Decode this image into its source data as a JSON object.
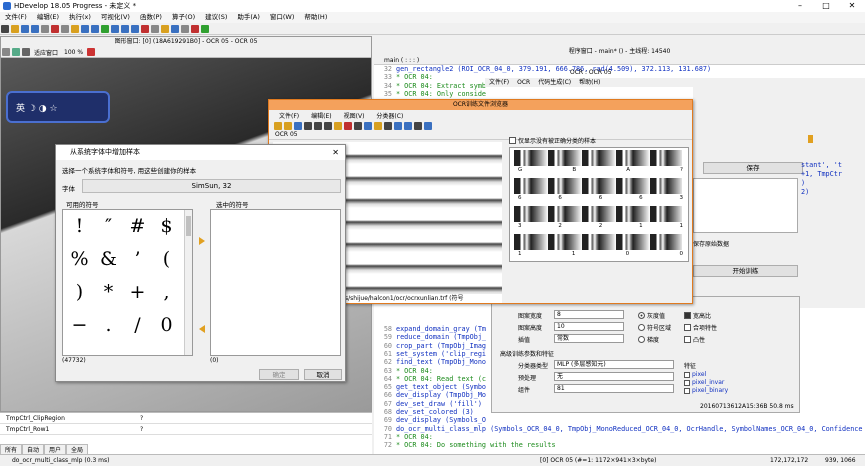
{
  "app": {
    "title": "HDevelop 18.05 Progress - 未定义 *"
  },
  "menu": [
    "文件(F)",
    "编辑(E)",
    "执行(x)",
    "可视化(V)",
    "函数(P)",
    "算子(O)",
    "建议(S)",
    "助手(A)",
    "窗口(W)",
    "帮助(H)"
  ],
  "graphics": {
    "title": "图形窗口: [0] (18A619291B0] - OCR 05 - OCR 05",
    "zoom_select": "适应窗口",
    "zoom_pct": "100 %"
  },
  "logo": {
    "text": "英 ☽ ◑ ☆"
  },
  "symbol_dialog": {
    "title": "从系统字体中增加样本",
    "instruction": "选择一个系统字体和符号, 用这些创建你的样本",
    "font_label": "字体",
    "font_value": "SimSun, 32",
    "available_label": "可用的符号",
    "selected_label": "选中的符号",
    "symbols": [
      "!",
      "″",
      "#",
      "$",
      "%",
      "&",
      "’",
      "(",
      ")",
      "*",
      "+",
      ",",
      "−",
      ".",
      "/",
      "0"
    ],
    "count_available": "(47732)",
    "count_selected": "(0)",
    "ok": "确定",
    "cancel": "取消"
  },
  "ocr_dialog": {
    "title": "OCR训练文件浏览器",
    "menu": [
      "文件(F)",
      "编辑(E)",
      "视图(V)",
      "分类器(C)"
    ],
    "tab": "OCR 05",
    "checkbox": "仅显示没有被正确分类的样本",
    "rows": [
      [
        "G",
        "B",
        "A",
        "?"
      ],
      [
        "6",
        "6",
        "6",
        "6",
        "3"
      ],
      [
        "3",
        "2",
        "2",
        "1",
        "1"
      ],
      [
        "1",
        "1",
        "0",
        "0"
      ]
    ],
    "path": "s/shijue/halcon1/ocr/ocrxunlian.trf (符号"
  },
  "assistant_menu": [
    "文件(F)",
    "OCR",
    "代码生成(C)",
    "帮助(H)"
  ],
  "assistant_title": "OCR : OCR 05",
  "assistant": {
    "save": "保存",
    "save_orig": "保存原始数据",
    "train": "开始训练"
  },
  "code_header": {
    "title": "程序窗口 - main* () - 主线程: 14540",
    "proc": "main ( : : : )"
  },
  "code_lines": [
    {
      "n": "32",
      "t": "gen_rectangle2 (ROI_OCR_04_0, 379.191, 666.786, rad(4.509), 372.113, 131.687)",
      "c": false
    },
    {
      "n": "33",
      "t": "* OCR 04:",
      "c": true
    },
    {
      "n": "34",
      "t": "* OCR 04: Extract symb",
      "c": true
    },
    {
      "n": "35",
      "t": "* OCR 04: Only conside",
      "c": true
    },
    {
      "n": "58",
      "t": "expand_domain_gray (Tm",
      "c": false
    },
    {
      "n": "59",
      "t": "reduce_domain (TmpObj_",
      "c": false
    },
    {
      "n": "60",
      "t": "crop_part (TmpObj_Imag",
      "c": false
    },
    {
      "n": "61",
      "t": "set_system ('clip_regi",
      "c": false
    },
    {
      "n": "62",
      "t": "find_text (TmpObj_Mono",
      "c": false
    },
    {
      "n": "63",
      "t": "* OCR 04:",
      "c": true
    },
    {
      "n": "64",
      "t": "* OCR 04: Read text (c",
      "c": true
    },
    {
      "n": "65",
      "t": "get_text_object (Symbo",
      "c": false
    },
    {
      "n": "66",
      "t": "dev_display (TmpObj_Mo",
      "c": false
    },
    {
      "n": "67",
      "t": "dev_set_draw ('fill')",
      "c": false
    },
    {
      "n": "68",
      "t": "dev_set_colored (3)",
      "c": false
    },
    {
      "n": "69",
      "t": "dev_display (Symbols_O",
      "c": false
    },
    {
      "n": "70",
      "t": "do_ocr_multi_class_mlp (Symbols_OCR_04_0, TmpObj_MonoReduced_OCR_04_0, OcrHandle, SymbolNames_OCR_04_0, Confidence",
      "c": false
    },
    {
      "n": "71",
      "t": "* OCR 04:",
      "c": true
    },
    {
      "n": "72",
      "t": "* OCR 04: Do something with the results",
      "c": true
    }
  ],
  "code_right": [
    "stant', 't",
    "+1, TmpCtr",
    ")",
    "2)"
  ],
  "params": {
    "labels": [
      "图案宽度",
      "图案高度",
      "插值"
    ],
    "values": [
      "8",
      "10",
      "常数"
    ],
    "radios": [
      "灰度值",
      "符号区域",
      "梯度"
    ],
    "checks": [
      "宽高比",
      "合项特性",
      "凸性"
    ],
    "advanced": "高级训练参数和特征",
    "adv_labels": [
      "分类器类型",
      "预处理",
      "组件"
    ],
    "adv_values": [
      "MLP (多层感知元)",
      "无",
      "81"
    ],
    "feat_label": "特征",
    "features": [
      "pixel",
      "pixel_invar",
      "pixel_binary"
    ],
    "timestamp": "20160713612A15:36B 50.8 ms"
  },
  "variables": [
    {
      "name": "TmpCtrl_ClipRegion",
      "val": "?"
    },
    {
      "name": "TmpCtrl_Row1",
      "val": "?"
    }
  ],
  "var_tabs": [
    "所有",
    "自动",
    "用户",
    "全局"
  ],
  "status": {
    "left": "do_ocr_multi_class_mlp (0.3 ms)",
    "mid": "[0] OCR 05 (#=1: 1172×941×3×byte)",
    "right": "172,172,172",
    "coords": "939, 1066"
  }
}
